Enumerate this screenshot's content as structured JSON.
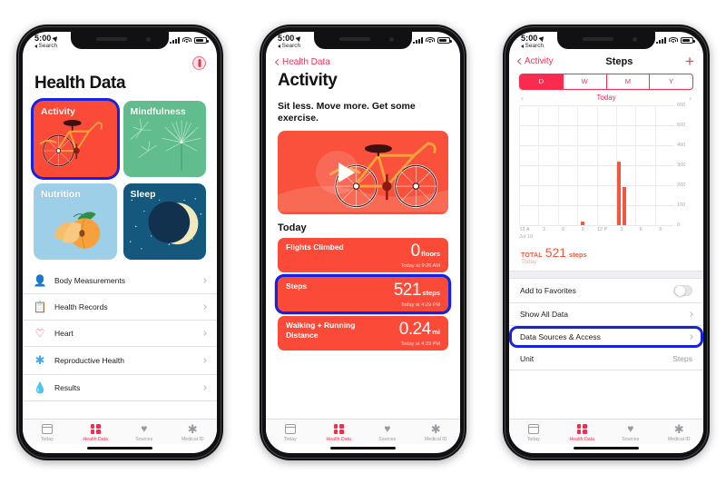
{
  "statusbar": {
    "time": "5:00",
    "back_label": "Search"
  },
  "phone1": {
    "title": "Health Data",
    "avatar_name": "profile-avatar",
    "cards": [
      {
        "label": "Activity",
        "color": "#fb4b38",
        "highlighted": true
      },
      {
        "label": "Mindfulness",
        "color": "#62bd8e",
        "highlighted": false
      },
      {
        "label": "Nutrition",
        "color": "#9ecfe8",
        "highlighted": false
      },
      {
        "label": "Sleep",
        "color": "#14597d",
        "highlighted": false
      }
    ],
    "list": [
      {
        "label": "Body Measurements",
        "icon": "body-icon"
      },
      {
        "label": "Health Records",
        "icon": "clipboard-icon"
      },
      {
        "label": "Heart",
        "icon": "heart-icon"
      },
      {
        "label": "Reproductive Health",
        "icon": "asterisk-icon"
      },
      {
        "label": "Results",
        "icon": "flask-icon"
      }
    ]
  },
  "phone2": {
    "back": "Health Data",
    "title": "Activity",
    "subhead": "Sit less. Move more. Get some exercise.",
    "video_label": "activity-video",
    "section": "Today",
    "metrics": [
      {
        "label": "Flights Climbed",
        "value": "0",
        "unit": "floors",
        "timestamp": "Today at 9:26 AM",
        "highlighted": false
      },
      {
        "label": "Steps",
        "value": "521",
        "unit": "steps",
        "timestamp": "Today at 4:29 PM",
        "highlighted": true
      },
      {
        "label": "Walking + Running Distance",
        "value": "0.24",
        "unit": "mi",
        "timestamp": "Today at 4:29 PM",
        "highlighted": false
      }
    ]
  },
  "phone3": {
    "back": "Activity",
    "title": "Steps",
    "add_label": "+",
    "segments": [
      {
        "label": "D",
        "selected": true
      },
      {
        "label": "W",
        "selected": false
      },
      {
        "label": "M",
        "selected": false
      },
      {
        "label": "Y",
        "selected": false
      }
    ],
    "daynav": {
      "label": "Today",
      "prev": "‹",
      "next": "›"
    },
    "total": {
      "prefix": "TOTAL",
      "value": "521",
      "unit": "steps",
      "sub": "Today"
    },
    "settings": [
      {
        "label": "Add to Favorites",
        "type": "toggle",
        "value": "off",
        "highlighted": false
      },
      {
        "label": "Show All Data",
        "type": "chevron",
        "value": "",
        "highlighted": false
      },
      {
        "label": "Data Sources & Access",
        "type": "chevron",
        "value": "",
        "highlighted": true
      },
      {
        "label": "Unit",
        "type": "value",
        "value": "Steps",
        "highlighted": false
      }
    ]
  },
  "tabbar": [
    {
      "label": "Today",
      "icon": "calendar-icon",
      "active": false
    },
    {
      "label": "Health Data",
      "icon": "grid-icon",
      "active": true
    },
    {
      "label": "Sources",
      "icon": "heart-download-icon",
      "active": false
    },
    {
      "label": "Medical ID",
      "icon": "asterisk-icon",
      "active": false
    }
  ],
  "chart_data": {
    "type": "bar",
    "title": "Steps",
    "xlabel": "",
    "ylabel": "steps",
    "ylim": [
      0,
      600
    ],
    "yticks": [
      0,
      100,
      200,
      300,
      400,
      500,
      600
    ],
    "xticks": [
      "12 A",
      "3",
      "6",
      "9",
      "12 P",
      "3",
      "6",
      "9"
    ],
    "date_label": "Jul 19",
    "grid": true,
    "bar_color": "#f4573f",
    "x": [
      9.6,
      15.2,
      16.0
    ],
    "values": [
      15,
      315,
      190
    ],
    "total": 521,
    "total_unit": "steps"
  },
  "accent": {
    "pink": "#fb2b50",
    "red_card": "#fb4b38",
    "highlight_blue": "#1522e0"
  }
}
